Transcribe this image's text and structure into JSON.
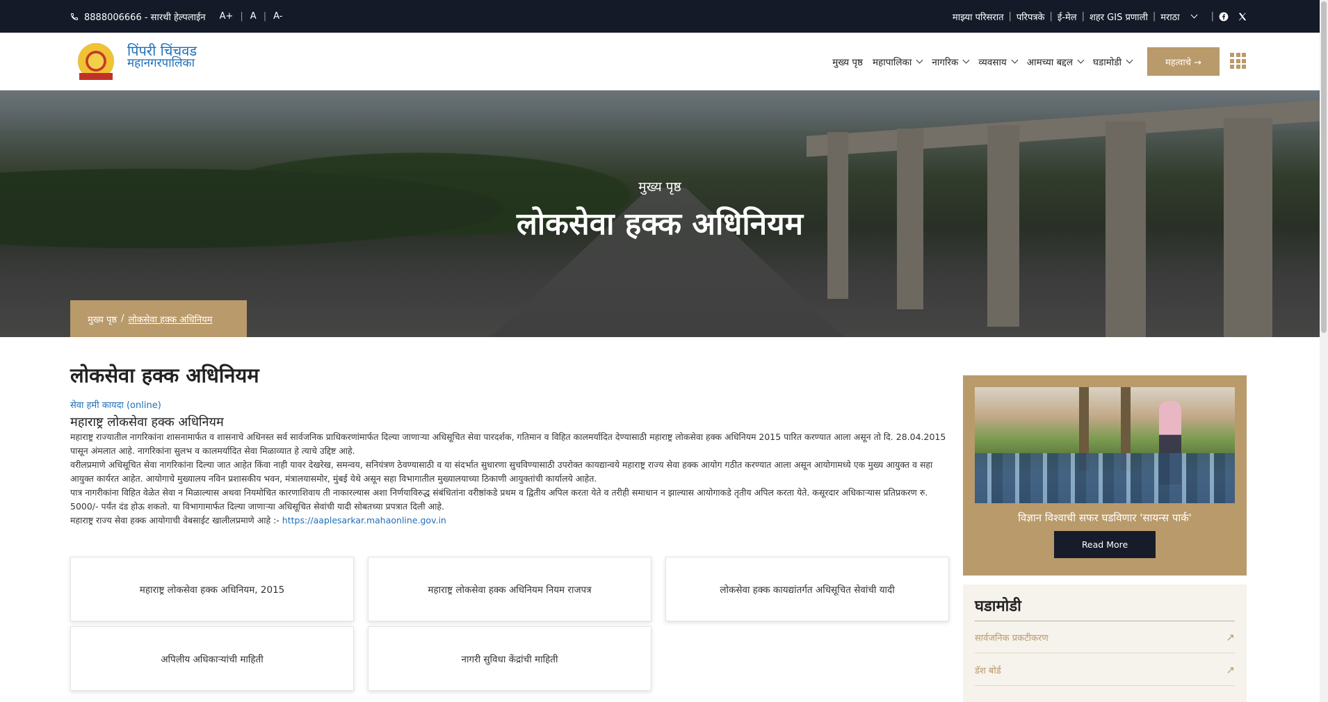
{
  "topbar": {
    "helpline": "8888006666 - सारथी हेल्पलाईन",
    "font_sizes": [
      "A+",
      "A",
      "A-"
    ],
    "links": [
      "माझ्या परिसरात",
      "परिपत्रके",
      "ई-मेल",
      "शहर GIS प्रणाली"
    ],
    "language": "मराठा"
  },
  "header": {
    "brand_line1": "पिंपरी चिंचवड",
    "brand_line2": "महानगरपालिका",
    "nav": [
      {
        "label": "मुख्य पृष्ठ",
        "dropdown": false
      },
      {
        "label": "महापालिका",
        "dropdown": true
      },
      {
        "label": "नागरिक",
        "dropdown": true
      },
      {
        "label": "व्यवसाय",
        "dropdown": true
      },
      {
        "label": "आमच्या बद्दल",
        "dropdown": true
      },
      {
        "label": "घडामोडी",
        "dropdown": true
      }
    ],
    "cta_label": "महत्वाचे →"
  },
  "hero": {
    "crumb": "मुख्य पृष्ठ",
    "title": "लोकसेवा हक्क अधिनियम",
    "breadcrumb_home": "मुख्य पृष्ठ",
    "breadcrumb_sep": "/",
    "breadcrumb_current": "लोकसेवा हक्क अधिनियम"
  },
  "main": {
    "heading": "लोकसेवा हक्क अधिनियम",
    "online_link": "सेवा हमी कायदा (online)",
    "sub_heading": "महाराष्ट्र लोकसेवा हक्क अधिनियम",
    "para1": "महाराष्ट्र राज्यातील नागरिकांना शासनामार्फत व शासनाचे अधिनस्त सर्व सार्वजनिक प्राधिकरणांमार्फत दिल्या जाणाऱ्या अधिसूचित सेवा पारदर्शक, गतिमान व विहित कालमर्यादित देण्यासाठी महाराष्ट्र लोकसेवा हक्क अधिनियम 2015 पारित करण्यात आला असून तो दि. 28.04.2015 पासून अंमलात आहे. नागरिकांना सुलभ व कालमर्यादित सेवा मिळाव्यात हे त्याचे उद्दिष्ट आहे.",
    "para2": "वरीलप्रमाणे अधिसूचित सेवा नागरिकांना दिल्या जात आहेत किंवा नाही यावर देखरेख, समन्वय, सनियंत्रण ठेवण्यासाठी व या संदर्भात सुधारणा सुचविण्यासाठी उपरोक्त कायद्यान्वये महाराष्ट्र राज्य सेवा हक्क आयोग गठीत करण्यात आला असून आयोगामध्ये एक मुख्य आयुक्त व सहा आयुक्त कार्यरत आहेत. आयोगाचे मुख्यालय नविन प्रशासकीय भवन, मंत्रालयासमोर, मुंबई येथे असून सहा विभागातील मुख्यालयाच्या ठिकाणी आयुक्तांची कार्यालये आहेत.",
    "para3": "पात्र नागरीकांना विहित वेळेत सेवा न मिळाल्यास अथवा नियमोचित कारणाशिवाय ती नाकारल्यास अशा निर्णयाविरुद्ध संबंधितांना वरीष्ठांकडे प्रथम व द्वितीय अपिल करता येते व तरीही समाधान न झाल्यास आयोगाकडे तृतीय अपिल करता येते. कसूरदार अधिकाऱ्यास प्रतिप्रकरण रु. 5000/- पर्यंत दंड होऊ शकतो. या विभागामार्फत दिल्या जाणाऱ्या अधिसूचित सेवांची यादी सोबतच्या प्रपत्रात दिली आहे.",
    "para4_prefix": "महाराष्ट्र राज्य सेवा हक्क आयोगाची वेबसाईट खालीलप्रमाणे आहे :- ",
    "para4_link": "https://aaplesarkar.mahaonline.gov.in"
  },
  "cards": [
    "महाराष्ट्र लोकसेवा हक्क अधिनियम, 2015",
    "महाराष्ट्र लोकसेवा हक्क अधिनियम नियम राजपत्र",
    "लोकसेवा हक्क कायद्यांतर्गत अधिसूचित सेवांची यादी",
    "अपिलीय अधिकाऱ्यांची माहिती",
    "नागरी सुविधा केंद्रांची माहिती"
  ],
  "sidebar": {
    "news_caption": "विज्ञान विश्वाची सफर घडविणार 'सायन्स पार्क'",
    "read_more": "Read More",
    "box_title": "घडामोडी",
    "box_items": [
      "सार्वजनिक प्रकटीकरण",
      "डॅश बोर्ड"
    ]
  },
  "colors": {
    "topbar_bg": "#141a28",
    "accent_gold": "#b99a6a",
    "brand_blue": "#1d6fb8",
    "dark_button": "#161c2a"
  }
}
